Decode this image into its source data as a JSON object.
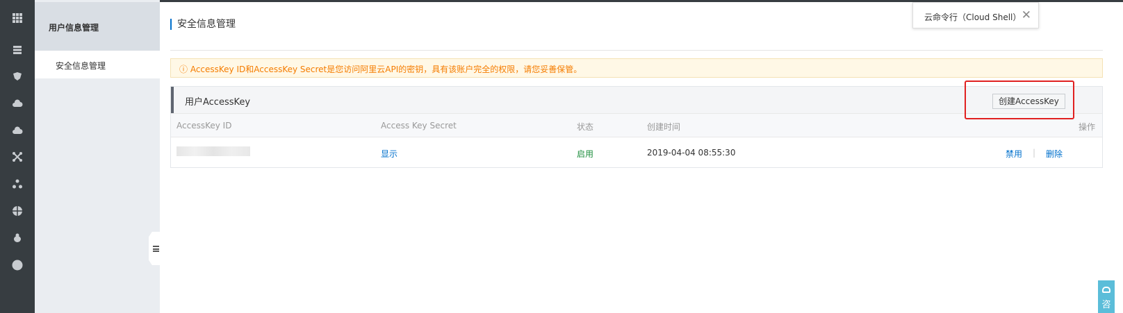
{
  "window": {
    "subnav_title": "用户信息管理"
  },
  "rail": {
    "icons": [
      "apps-grid-icon",
      "database-icon",
      "shield-icon",
      "cloud-icon",
      "cloud-upload-icon",
      "network-icon",
      "cluster-icon",
      "globe-icon",
      "bug-icon",
      "circle-icon"
    ]
  },
  "sidebar": {
    "items": [
      {
        "label": "安全信息管理",
        "active": true
      }
    ]
  },
  "page": {
    "title": "安全信息管理"
  },
  "shell_tip": {
    "label": "云命令行（Cloud Shell）",
    "close": "✕"
  },
  "alert": {
    "text": "ⓘ AccessKey ID和AccessKey Secret是您访问阿里云API的密钥，具有该账户完全的权限，请您妥善保管。"
  },
  "panel": {
    "title": "用户AccessKey",
    "create_button": "创建AccessKey",
    "columns": [
      "AccessKey ID",
      "Access Key Secret",
      "状态",
      "创建时间",
      "操作"
    ],
    "rows": [
      {
        "secret_action": "显示",
        "status": "启用",
        "created": "2019-04-04 08:55:30",
        "actions": [
          "禁用",
          "删除"
        ],
        "separator": "|"
      }
    ]
  },
  "float_help": {
    "label": "咨"
  },
  "colors": {
    "accent": "#0070cc",
    "warning": "#f57c00",
    "success": "#1e8e3e",
    "rail": "#373d41",
    "highlight": "#e02020"
  }
}
